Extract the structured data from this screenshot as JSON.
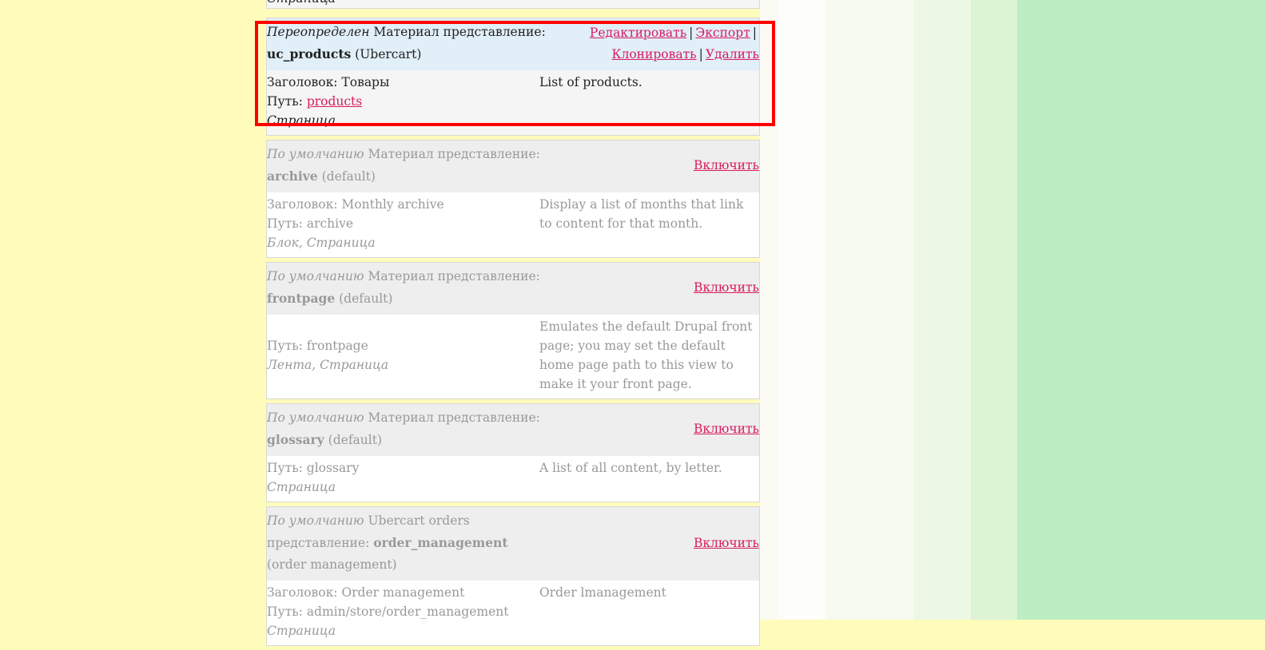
{
  "top_stub": "Страница",
  "views": [
    {
      "status": "Переопределен",
      "type_label": "Материал представление:",
      "name": "uc_products",
      "tag": "(Ubercart)",
      "enabled": true,
      "actions": {
        "edit": "Редактировать",
        "export": "Экспорт",
        "clone": "Клонировать",
        "delete": "Удалить",
        "sep": "|"
      },
      "title_line": "Заголовок: Товары",
      "path_label": "Путь:",
      "path_link": "products",
      "displays": "Страница",
      "description": "List of products."
    },
    {
      "status": "По умолчанию",
      "type_label": "Материал представление:",
      "name": "archive",
      "tag": "(default)",
      "action_enable": "Включить",
      "title_line": "Заголовок: Monthly archive",
      "path_line": "Путь: archive",
      "displays": "Блок, Страница",
      "description": "Display a list of months that link to content for that month."
    },
    {
      "status": "По умолчанию",
      "type_label": "Материал представление:",
      "name": "frontpage",
      "tag": "(default)",
      "action_enable": "Включить",
      "path_line": "Путь: frontpage",
      "displays": "Лента, Страница",
      "description": "Emulates the default Drupal front page; you may set the default home page path to this view to make it your front page."
    },
    {
      "status": "По умолчанию",
      "type_label": "Материал представление:",
      "name": "glossary",
      "tag": "(default)",
      "action_enable": "Включить",
      "path_line": "Путь: glossary",
      "displays": "Страница",
      "description": "A list of all content, by letter."
    },
    {
      "status": "По умолчанию",
      "type_label_1": "Ubercart orders",
      "type_label_2": "представление:",
      "name": "order_management",
      "tag": "(order management)",
      "action_enable": "Включить",
      "title_line": "Заголовок: Order management",
      "path_line": "Путь: admin/store/order_management",
      "displays": "Страница",
      "description": "Order lmanagement"
    }
  ],
  "colors": {
    "link": "#d81b60",
    "highlight": "#ff0000",
    "enabled_header": "#e1eff8",
    "disabled_header": "#eeeeee"
  }
}
